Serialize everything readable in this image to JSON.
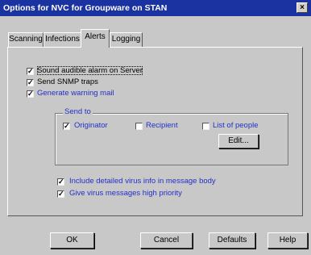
{
  "window": {
    "title": "Options for NVC for Groupware on STAN",
    "close_glyph": "×"
  },
  "tabs": [
    {
      "label": "Scanning",
      "active": false
    },
    {
      "label": "Infections",
      "active": false
    },
    {
      "label": "Alerts",
      "active": true
    },
    {
      "label": "Logging",
      "active": false
    }
  ],
  "alerts": {
    "options": [
      {
        "label": "Sound audible alarm on Server",
        "checked": true
      },
      {
        "label": "Send SNMP traps",
        "checked": true
      },
      {
        "label": "Generate warning mail",
        "checked": true
      }
    ],
    "send_to": {
      "title": "Send to",
      "originator": {
        "label": "Originator",
        "checked": true
      },
      "recipient": {
        "label": "Recipient",
        "checked": false
      },
      "list_of_people": {
        "label": "List of people",
        "checked": false
      },
      "edit_label": "Edit..."
    },
    "mail_options": [
      {
        "label": "Include detailed virus info in message body",
        "checked": true
      },
      {
        "label": "Give virus messages high priority",
        "checked": true
      }
    ]
  },
  "buttons": {
    "ok": "OK",
    "cancel": "Cancel",
    "defaults": "Defaults",
    "help": "Help"
  },
  "glyphs": {
    "check": "✓"
  },
  "colors": {
    "titlebar": "#1a33a0",
    "dialog": "#c8c8c8",
    "blue_text": "#2230c8"
  }
}
